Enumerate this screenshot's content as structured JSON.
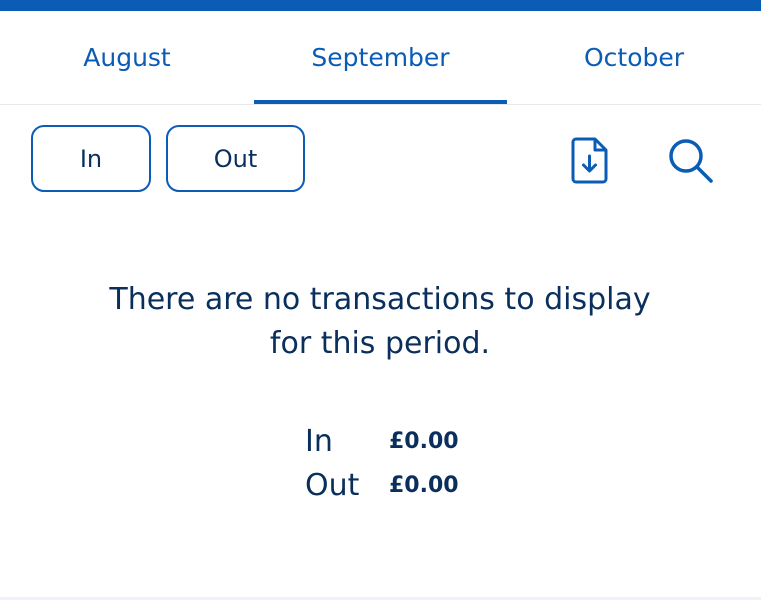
{
  "tabs": [
    {
      "label": "August"
    },
    {
      "label": "September",
      "selected": true
    },
    {
      "label": "October"
    }
  ],
  "filters": {
    "in_label": "In",
    "out_label": "Out"
  },
  "icons": {
    "download": "download-statement-icon",
    "search": "search-icon"
  },
  "empty_state": {
    "line1": "There are no transactions to display",
    "line2": "for this period."
  },
  "totals": {
    "in_label": "In",
    "in_value": "£0.00",
    "out_label": "Out",
    "out_value": "£0.00"
  },
  "colors": {
    "accent": "#0b5cb5",
    "text": "#0a2f5c"
  }
}
